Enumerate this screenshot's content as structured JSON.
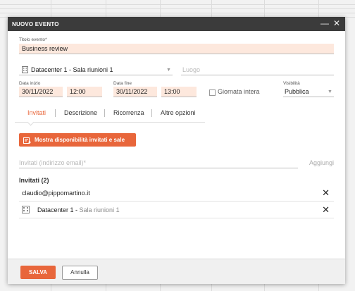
{
  "dialog": {
    "title": "NUOVO EVENTO",
    "minimize_symbol": "—",
    "close_symbol": "✕"
  },
  "form": {
    "title_label": "Titolo evento*",
    "title_value": "Business review",
    "resource_value": "Datacenter 1 - Sala riunioni 1",
    "location_placeholder": "Luogo",
    "start_label": "Data inizio",
    "start_date": "30/11/2022",
    "start_time": "12:00",
    "end_label": "Data fine",
    "end_date": "30/11/2022",
    "end_time": "13:00",
    "all_day_label": "Giornata intera",
    "all_day_checked": false,
    "visibility_label": "Visibilità",
    "visibility_value": "Pubblica"
  },
  "tabs": [
    {
      "label": "Invitati",
      "active": true
    },
    {
      "label": "Descrizione",
      "active": false
    },
    {
      "label": "Ricorrenza",
      "active": false
    },
    {
      "label": "Altre opzioni",
      "active": false
    }
  ],
  "availability_button_label": "Mostra disponibilità invitati e sale",
  "invitees": {
    "input_placeholder": "Invitati (indirizzo email)*",
    "add_label": "Aggiungi",
    "heading": "Invitati (2)",
    "items": [
      {
        "name": "claudio@pippomartino.it",
        "detail": ""
      },
      {
        "name": "Datacenter 1 - ",
        "detail": "Sala riunioni 1"
      }
    ]
  },
  "footer": {
    "save_label": "SALVA",
    "cancel_label": "Annulla"
  },
  "colors": {
    "accent": "#e8663b",
    "field_bg": "#fde8dd",
    "titlebar": "#3b3b3b"
  }
}
